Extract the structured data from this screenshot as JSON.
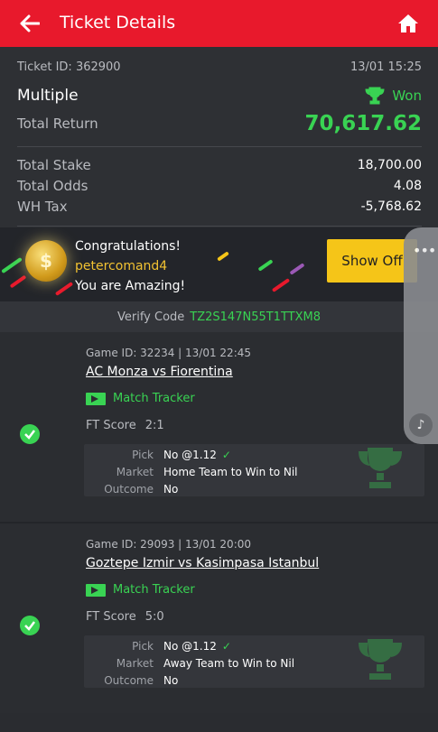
{
  "header": {
    "title": "Ticket Details",
    "back_icon": "arrow-left-icon",
    "home_icon": "home-icon"
  },
  "ticket": {
    "id": "Ticket ID: 362900",
    "datetime": "13/01 15:25",
    "type": "Multiple",
    "status": "Won",
    "total_return_label": "Total Return",
    "total_return": "70,617.62",
    "total_stake_label": "Total Stake",
    "total_stake": "18,700.00",
    "total_odds_label": "Total Odds",
    "total_odds": "4.08",
    "wh_tax_label": "WH Tax",
    "wh_tax": "-5,768.62"
  },
  "banner": {
    "line1": "Congratulations!",
    "username": "petercomand4",
    "line3": "You are Amazing!",
    "button": "Show Off"
  },
  "verify": {
    "label": "Verify Code",
    "code": "TZ2S147N55T1TTXM8"
  },
  "games": [
    {
      "id": "Game ID: 32234 | 13/01 22:45",
      "teams": "AC Monza vs Fiorentina",
      "tracker": "Match Tracker",
      "ft_label": "FT Score",
      "ft_score": "2:1",
      "pick_label": "Pick",
      "pick": "No @1.12",
      "market_label": "Market",
      "market": "Home Team to Win to Nil",
      "outcome_label": "Outcome",
      "outcome": "No"
    },
    {
      "id": "Game ID: 29093 | 13/01 20:00",
      "teams": "Goztepe Izmir vs Kasimpasa Istanbul",
      "tracker": "Match Tracker",
      "ft_label": "FT Score",
      "ft_score": "5:0",
      "pick_label": "Pick",
      "pick": "No @1.12",
      "market_label": "Market",
      "market": "Away Team to Win to Nil",
      "outcome_label": "Outcome",
      "outcome": "No"
    }
  ],
  "colors": {
    "accent": "#e8192c",
    "win": "#39d353",
    "gold": "#f5c518"
  }
}
